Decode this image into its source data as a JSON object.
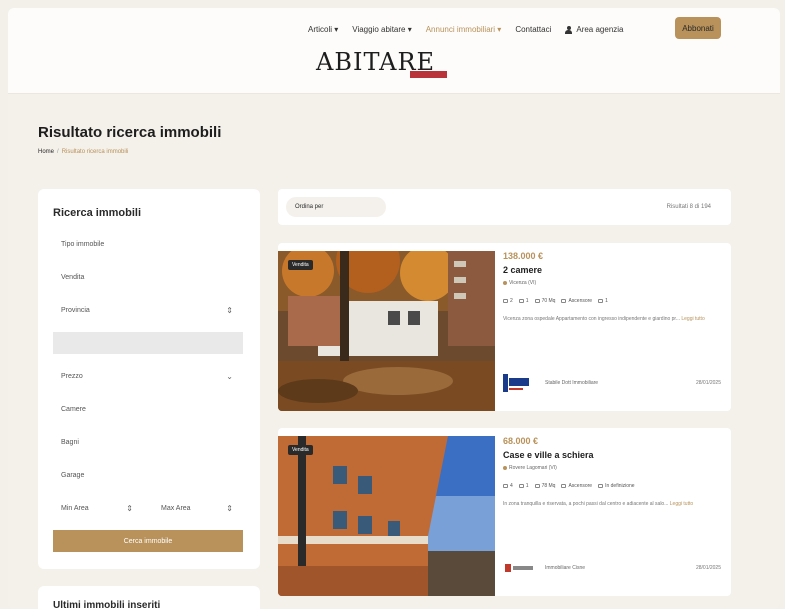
{
  "header": {
    "nav": [
      {
        "label": "Articoli ▾"
      },
      {
        "label": "Viaggio abitare ▾"
      },
      {
        "label": "Annunci immobiliari ▾"
      },
      {
        "label": "Contattaci"
      }
    ],
    "area_agenzia": "Area agenzia",
    "subscribe": "Abbonati",
    "logo": "ABITARE"
  },
  "page": {
    "title": "Risultato ricerca immobili",
    "breadcrumb": {
      "home": "Home",
      "sep": "/",
      "current": "Risultato ricerca immobili"
    }
  },
  "sidebar": {
    "title": "Ricerca immobili",
    "fields": {
      "tipo": "Tipo immobile",
      "vendita": "Vendita",
      "provincia": "Provincia",
      "prezzo": "Prezzo",
      "camere": "Camere",
      "bagni": "Bagni",
      "garage": "Garage",
      "min_area": "Min Area",
      "max_area": "Max Area"
    },
    "search_button": "Cerca immobile",
    "latest_title": "Ultimi immobili inseriti"
  },
  "results": {
    "sort_label": "Ordina per",
    "count": "Risultati 8 di 194",
    "cards": [
      {
        "badge": "Vendita",
        "price": "138.000 €",
        "title": "2 camere",
        "location": "Vicenza (VI)",
        "features": [
          "2",
          "1",
          "70 Mq",
          "Ascensore",
          "1"
        ],
        "description": "Vicenza zona ospedale Appartamento con ingresso indipendente e giardino pr...",
        "read_more": "Leggi tutto",
        "agency": "Stabile Dott Immobiliare",
        "date": "28/01/2025"
      },
      {
        "badge": "Vendita",
        "price": "68.000 €",
        "title": "Case e ville a schiera",
        "location": "Rovere Lagomari (VI)",
        "features": [
          "4",
          "1",
          "78 Mq",
          "Ascensore",
          "In definizione"
        ],
        "description": "In zona tranquilla e riservata, a pochi passi dal centro e adiacente al salo...",
        "read_more": "Leggi tutto",
        "agency": "Immobiliare Cisne",
        "date": "28/01/2025"
      }
    ]
  },
  "colors": {
    "accent": "#b8925a",
    "background": "#f4f0ea",
    "logo_red": "#b8333a"
  }
}
